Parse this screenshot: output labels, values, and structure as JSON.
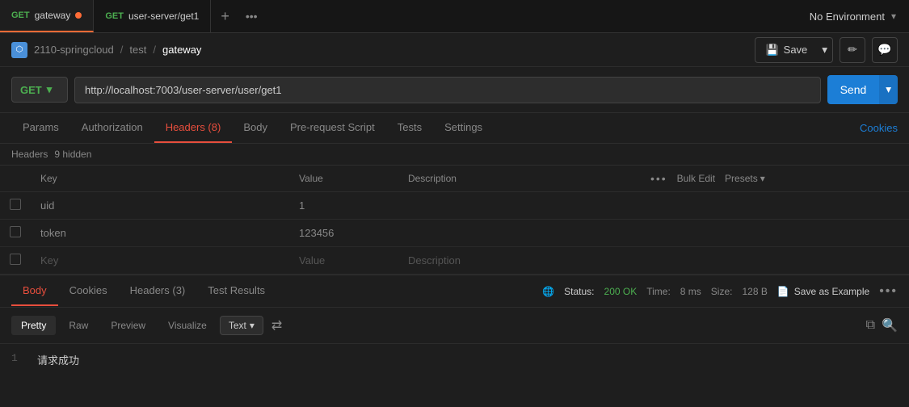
{
  "tabs": [
    {
      "id": "tab1",
      "method": "GET",
      "method_color": "#4CAF50",
      "label": "gateway",
      "active": true,
      "has_dot": true
    },
    {
      "id": "tab2",
      "method": "GET",
      "method_color": "#4CAF50",
      "label": "user-server/get1",
      "active": false,
      "has_dot": false
    }
  ],
  "tab_bar": {
    "add_label": "+",
    "more_label": "•••",
    "env_label": "No Environment"
  },
  "breadcrumb": {
    "workspace": "2110-springcloud",
    "sep1": "/",
    "collection": "test",
    "sep2": "/",
    "current": "gateway",
    "icon_label": "⌂"
  },
  "toolbar": {
    "save_label": "Save",
    "save_icon": "💾",
    "edit_icon": "✏",
    "comment_icon": "💬",
    "caret": "▾"
  },
  "url_bar": {
    "method": "GET",
    "url": "http://localhost:7003/user-server/user/get1",
    "send_label": "Send",
    "caret": "▾"
  },
  "request_tabs": {
    "items": [
      {
        "label": "Params",
        "active": false
      },
      {
        "label": "Authorization",
        "active": false
      },
      {
        "label": "Headers (8)",
        "active": true
      },
      {
        "label": "Body",
        "active": false
      },
      {
        "label": "Pre-request Script",
        "active": false
      },
      {
        "label": "Tests",
        "active": false
      },
      {
        "label": "Settings",
        "active": false
      }
    ],
    "cookies_link": "Cookies"
  },
  "headers_sub": {
    "label1": "Headers",
    "label2": "9 hidden"
  },
  "headers_table": {
    "columns": [
      "",
      "Key",
      "Value",
      "Description",
      "",
      "Bulk Edit",
      "Presets"
    ],
    "rows": [
      {
        "checked": false,
        "key": "uid",
        "value": "1",
        "description": ""
      },
      {
        "checked": false,
        "key": "token",
        "value": "123456",
        "description": ""
      },
      {
        "checked": false,
        "key": "Key",
        "value": "Value",
        "description": "Description"
      }
    ]
  },
  "response_tabs": {
    "items": [
      {
        "label": "Body",
        "active": true
      },
      {
        "label": "Cookies",
        "active": false
      },
      {
        "label": "Headers (3)",
        "active": false
      },
      {
        "label": "Test Results",
        "active": false
      }
    ],
    "status_label": "Status:",
    "status_value": "200 OK",
    "time_label": "Time:",
    "time_value": "8 ms",
    "size_label": "Size:",
    "size_value": "128 B",
    "save_example_icon": "📄",
    "save_example_label": "Save as Example",
    "more": "•••",
    "globe_icon": "🌐"
  },
  "response_toolbar": {
    "view_buttons": [
      {
        "label": "Pretty",
        "active": true
      },
      {
        "label": "Raw",
        "active": false
      },
      {
        "label": "Preview",
        "active": false
      },
      {
        "label": "Visualize",
        "active": false
      }
    ],
    "format_label": "Text",
    "format_caret": "▾",
    "wrap_icon": "⇌",
    "copy_icon": "⧉",
    "search_icon": "🔍"
  },
  "response_body": {
    "lines": [
      {
        "num": 1,
        "text": "请求成功"
      }
    ]
  }
}
